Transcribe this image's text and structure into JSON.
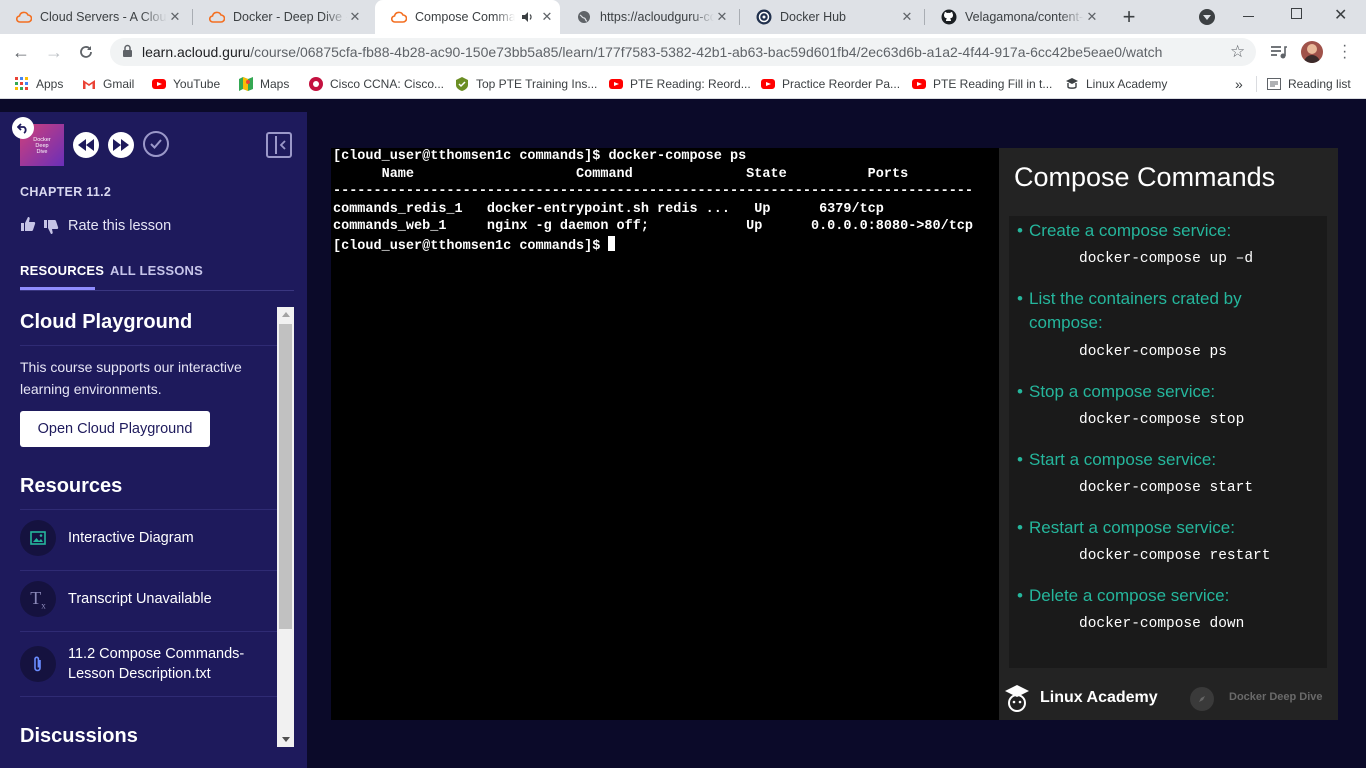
{
  "tabs": [
    {
      "title": "Cloud Servers - A Cloud Guru",
      "active": false
    },
    {
      "title": "Docker - Deep Dive - A Cloud Guru",
      "active": false
    },
    {
      "title": "Compose Commands",
      "active": true
    },
    {
      "title": "https://acloudguru-content",
      "active": false
    },
    {
      "title": "Docker Hub",
      "active": false
    },
    {
      "title": "Velagamona/content-docker",
      "active": false
    }
  ],
  "address": {
    "host": "learn.acloud.guru",
    "path": "/course/06875cfa-fb88-4b28-ac90-150e73bb5a85/learn/177f7583-5382-42b1-ab63-bac59d601fb4/2ec63d6b-a1a2-4f44-917a-6cc42be5eae0/watch"
  },
  "bookmarks": [
    {
      "label": "Apps",
      "icon": "apps-grid-icon"
    },
    {
      "label": "Gmail",
      "icon": "gmail-icon"
    },
    {
      "label": "YouTube",
      "icon": "youtube-icon"
    },
    {
      "label": "Maps",
      "icon": "maps-icon"
    },
    {
      "label": "Cisco CCNA: Cisco...",
      "icon": "cisco-icon"
    },
    {
      "label": "Top PTE Training Ins...",
      "icon": "pte-icon"
    },
    {
      "label": "PTE Reading: Reord...",
      "icon": "youtube-icon"
    },
    {
      "label": "Practice Reorder Pa...",
      "icon": "youtube-icon"
    },
    {
      "label": "PTE Reading Fill in t...",
      "icon": "youtube-icon"
    },
    {
      "label": "Linux Academy",
      "icon": "linux-academy-icon"
    }
  ],
  "reading_list": "Reading list",
  "sidebar": {
    "thumb_text": "Docker Deep Dive",
    "chapter": "CHAPTER 11.2",
    "rate": "Rate this lesson",
    "tabs": [
      "RESOURCES",
      "ALL LESSONS"
    ],
    "playground_title": "Cloud Playground",
    "playground_desc": "This course supports our interactive learning environments.",
    "playground_btn": "Open Cloud Playground",
    "resources_title": "Resources",
    "resources": [
      {
        "label": "Interactive Diagram",
        "icon": "image-icon"
      },
      {
        "label": "Transcript Unavailable",
        "icon": "transcript-off-icon"
      },
      {
        "label": "11.2 Compose Commands-Lesson Description.txt",
        "icon": "attachment-icon"
      }
    ],
    "discussions_title": "Discussions"
  },
  "terminal": {
    "lines": [
      "[cloud_user@tthomsen1c commands]$ docker-compose ps",
      "      Name                    Command              State          Ports",
      "-------------------------------------------------------------------------------",
      "commands_redis_1   docker-entrypoint.sh redis ...   Up      6379/tcp",
      "commands_web_1     nginx -g daemon off;            Up      0.0.0.0:8080->80/tcp"
    ],
    "prompt": "[cloud_user@tthomsen1c commands]$ "
  },
  "slide": {
    "title": "Compose Commands",
    "items": [
      {
        "text": "Create a compose service:",
        "cmd": "docker-compose up –d"
      },
      {
        "text": "List the containers crated by compose:",
        "cmd": "docker-compose ps"
      },
      {
        "text": "Stop a compose service:",
        "cmd": "docker-compose stop"
      },
      {
        "text": "Start a compose service:",
        "cmd": "docker-compose start"
      },
      {
        "text": "Restart a compose service:",
        "cmd": "docker-compose restart"
      },
      {
        "text": "Delete a compose service:",
        "cmd": "docker-compose down"
      }
    ],
    "footer_brand": "Linux Academy",
    "footer_course": "Docker Deep Dive"
  },
  "colors": {
    "sidebar_bg": "#1e1a5c",
    "page_bg": "#0b0a29",
    "slide_accent": "#25b69c",
    "tab_active_underline": "#8f8cff"
  }
}
